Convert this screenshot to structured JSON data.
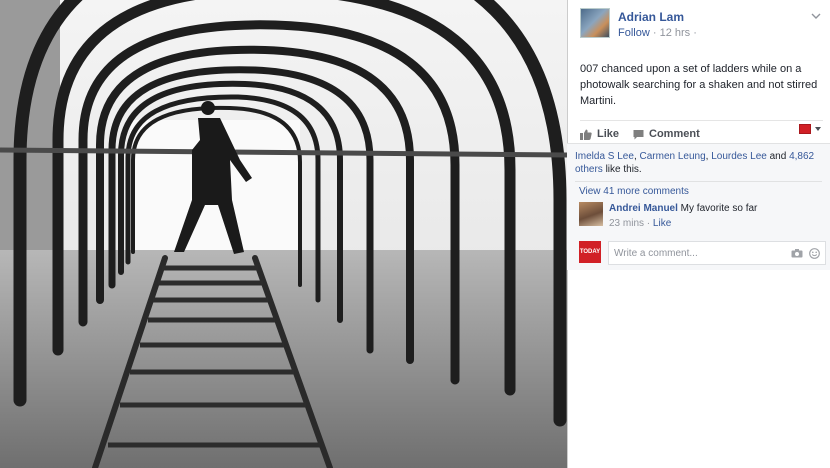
{
  "post": {
    "author": "Adrian Lam",
    "follow_label": "Follow",
    "separator": "·",
    "time": "12 hrs ·",
    "text": "007 chanced upon a set of ladders while on a photowalk searching for a shaken and not stirred Martini."
  },
  "actions": {
    "like_label": "Like",
    "comment_label": "Comment"
  },
  "likes": {
    "names": [
      "Imelda S Lee",
      "Carmen Leung",
      "Lourdes Lee"
    ],
    "sep1": ", ",
    "sep2": ", ",
    "and_text": " and ",
    "others_link": "4,862 others",
    "suffix": " like this."
  },
  "comments": {
    "view_more": "View 41 more comments",
    "items": [
      {
        "author": "Andrei Manuel",
        "text": " My favorite so far",
        "time": "23 mins",
        "separator": " · ",
        "like_label": "Like"
      }
    ],
    "input_placeholder": "Write a comment...",
    "page_logo_text": "TODAY"
  },
  "icons": {
    "like": "thumbs-up-icon",
    "comment": "speech-bubble-icon",
    "camera": "camera-icon",
    "emoji": "emoji-icon",
    "dropdown": "chevron-down-icon"
  },
  "colors": {
    "link": "#365899",
    "brand_red": "#d12026",
    "muted": "#90949c",
    "panel_bg": "#f6f7f9"
  }
}
